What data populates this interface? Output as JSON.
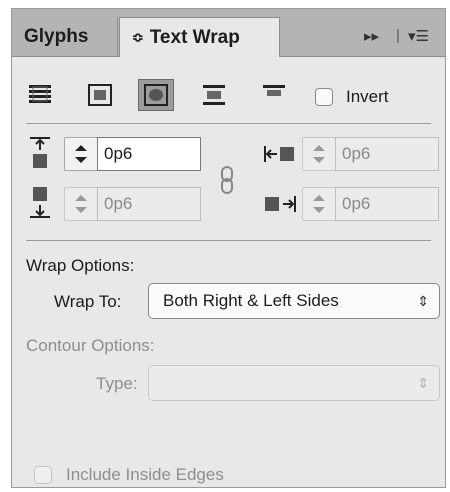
{
  "tabs": {
    "glyphs": "Glyphs",
    "text_wrap": "Text Wrap",
    "text_wrap_icon": "updown-arrows-icon"
  },
  "tabbar_controls": {
    "collapse": "▸▸",
    "menu": "▾☰"
  },
  "wrap_modes": {
    "selected": "object-shape",
    "items": [
      "no-wrap-icon",
      "bounding-box-wrap-icon",
      "object-shape-wrap-icon",
      "jump-object-wrap-icon",
      "jump-next-column-icon"
    ]
  },
  "invert": {
    "label": "Invert",
    "checked": false
  },
  "offsets": {
    "top": {
      "value": "0p6",
      "active": true
    },
    "bottom": {
      "value": "0p6"
    },
    "left": {
      "value": "0p6"
    },
    "right": {
      "value": "0p6"
    },
    "link_icon": "chain-link-icon"
  },
  "wrap_options": {
    "heading": "Wrap Options:",
    "wrap_to_label": "Wrap To:",
    "wrap_to_value": "Both Right & Left Sides"
  },
  "contour_options": {
    "heading": "Contour Options:",
    "type_label": "Type:",
    "type_value": ""
  },
  "include_inside_edges": {
    "label": "Include Inside Edges",
    "checked": false,
    "enabled": false
  }
}
